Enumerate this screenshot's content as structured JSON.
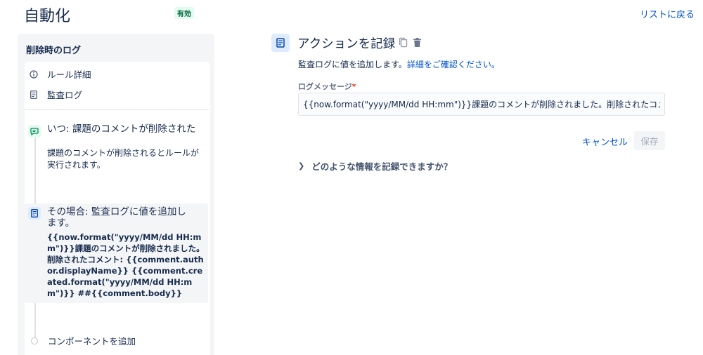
{
  "header": {
    "title": "自動化",
    "status": "有効",
    "back_link": "リストに戻る"
  },
  "sidebar": {
    "rule_name": "削除時のログ",
    "menu": [
      {
        "label": "ルール詳細",
        "icon": "info-icon"
      },
      {
        "label": "監査ログ",
        "icon": "document-icon"
      }
    ],
    "trigger": {
      "title": "いつ: 課題のコメントが削除された",
      "description": "課題のコメントが削除されるとルールが実行されます。",
      "icon": "comment-icon"
    },
    "action": {
      "title": "その場合: 監査ログに値を追加します。",
      "message": "{{now.format(\"yyyy/MM/dd HH:mm\")}}課題のコメントが削除されました。削除されたコメント: {{comment.author.displayName}} {{comment.created.format(\"yyyy/MM/dd HH:mm\")}} ##{{comment.body}}",
      "icon": "document-icon"
    },
    "add_component": "コンポーネントを追加"
  },
  "detail": {
    "title": "アクションを記録",
    "description": "監査ログに値を追加します。",
    "description_link": "詳細をご確認ください。",
    "field_label": "ログメッセージ",
    "required_mark": "*",
    "field_value": "{{now.format(\"yyyy/MM/dd HH:mm\")}}課題のコメントが削除されました。削除されたコメント: {{comment.author.displayName}} {{comment.created.format(\"yyyy/MM/dd HH:mm\")}} ##{{comment.body}}",
    "cancel_label": "キャンセル",
    "save_label": "保存",
    "expander_label": "どのような情報を記録できますか？"
  },
  "colors": {
    "link": "#0052cc",
    "status_bg": "#e3fcef",
    "status_text": "#006644",
    "panel_bg": "#f4f5f7"
  }
}
